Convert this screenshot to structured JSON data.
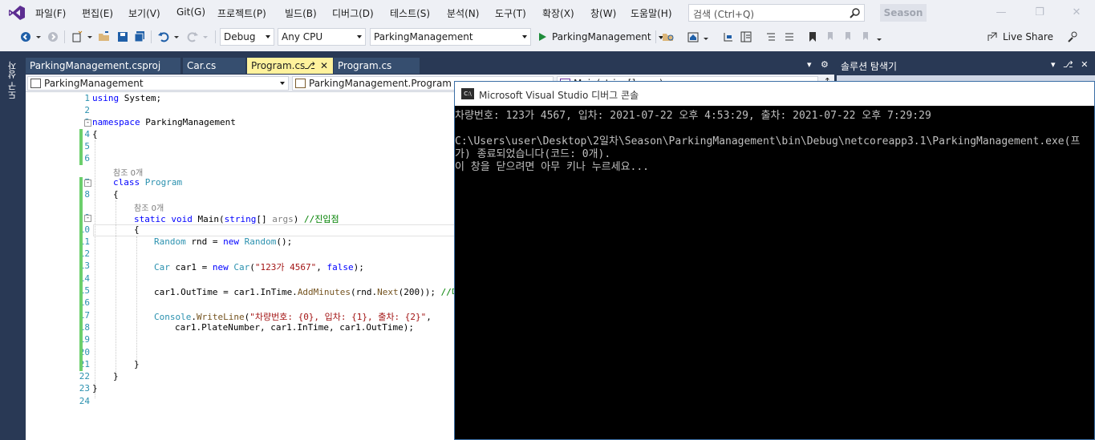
{
  "menubar": {
    "items": [
      "파일(F)",
      "편집(E)",
      "보기(V)",
      "Git(G)",
      "프로젝트(P)",
      "빌드(B)",
      "디버그(D)",
      "테스트(S)",
      "분석(N)",
      "도구(T)",
      "확장(X)",
      "창(W)",
      "도움말(H)"
    ],
    "search_placeholder": "검색 (Ctrl+Q)",
    "solution_name": "Season"
  },
  "toolbar": {
    "configuration": "Debug",
    "platform": "Any CPU",
    "startup_project": "ParkingManagement",
    "run_label": "ParkingManagement",
    "live_share": "Live Share"
  },
  "side_tab": "도구 상자",
  "tabs": [
    {
      "label": "ParkingManagement.csproj",
      "active": false
    },
    {
      "label": "Car.cs",
      "active": false
    },
    {
      "label": "Program.cs",
      "active": true
    },
    {
      "label": "Program.cs",
      "active": false
    }
  ],
  "navbar": {
    "project": "ParkingManagement",
    "type": "ParkingManagement.Program",
    "member": "Main(string[] args)"
  },
  "editor": {
    "line_numbers": [
      "1",
      "2",
      "3",
      "4",
      "5",
      "6",
      "7",
      "8",
      "9",
      "10",
      "11",
      "12",
      "13",
      "14",
      "15",
      "16",
      "17",
      "18",
      "19",
      "20",
      "21",
      "22",
      "23",
      "24"
    ],
    "ref_label": "참조 0개",
    "lines": {
      "l1_kw": "using",
      "l1_rest": " System;",
      "l3_kw": "namespace",
      "l3_rest": " ParkingManagement",
      "l4": "{",
      "l7_kw": "class",
      "l7_type": "Program",
      "l8": "{",
      "l9_kw": "static void",
      "l9_name": " Main(",
      "l9_kw2": "string",
      "l9_rest1": "[] ",
      "l9_param": "args",
      "l9_rest2": ") ",
      "l9_comment": "//진입점",
      "l10": "{",
      "l11_type": "Random",
      "l11_mid": " rnd = ",
      "l11_kw": "new",
      "l11_type2": " Random",
      "l11_end": "();",
      "l13_type": "Car",
      "l13_mid": " car1 = ",
      "l13_kw": "new",
      "l13_type2": " Car",
      "l13_p1": "(",
      "l13_str": "\"123가 4567\"",
      "l13_p2": ", ",
      "l13_kw2": "false",
      "l13_end": ");",
      "l15_code": "car1.OutTime = car1.InTime.",
      "l15_method": "AddMinutes",
      "l15_mid": "(rnd.",
      "l15_method2": "Next",
      "l15_end": "(200)); ",
      "l15_comment": "//다",
      "l17_type": "Console",
      "l17_dot": ".",
      "l17_method": "WriteLine",
      "l17_p": "(",
      "l17_str": "\"차량번호: {0}, 입차: {1}, 출차: {2}\"",
      "l17_end": ",",
      "l18": "car1.PlateNumber, car1.InTime, car1.OutTime);",
      "l21": "}",
      "l22": "}",
      "l23": "}"
    }
  },
  "solution_explorer": {
    "title": "솔루션 탐색기"
  },
  "console": {
    "title": "Microsoft Visual Studio 디버그 콘솔",
    "icon_text": "C:\\",
    "lines": [
      "차량번호: 123가 4567, 입차: 2021-07-22 오후 4:53:29, 출차: 2021-07-22 오후 7:29:29",
      "",
      "C:\\Users\\user\\Desktop\\2일차\\Season\\ParkingManagement\\bin\\Debug\\netcoreapp3.1\\ParkingManagement.exe(프",
      "가) 종료되었습니다(코드: 0개).",
      "이 창을 닫으려면 아무 키나 누르세요..."
    ]
  },
  "colors": {
    "frame": "#293955",
    "active_tab": "#fff29d",
    "keyword": "#0000ff",
    "type": "#2b91af",
    "string": "#a31515",
    "comment": "#008000"
  }
}
